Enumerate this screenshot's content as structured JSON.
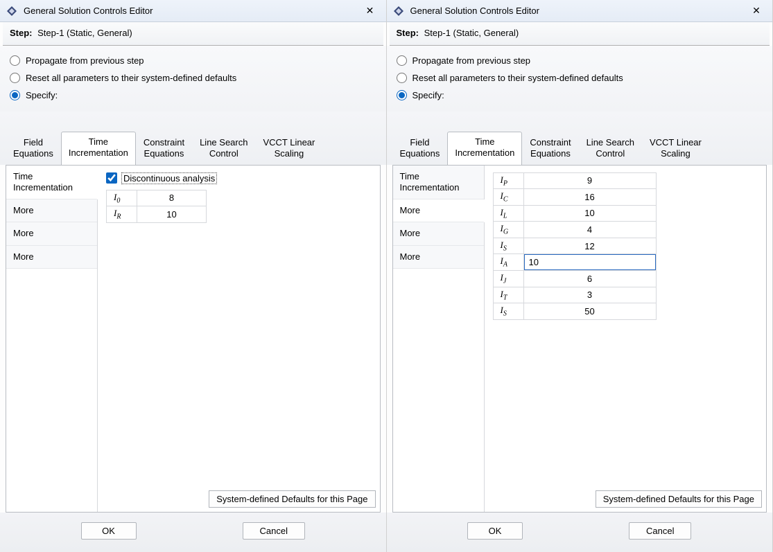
{
  "left": {
    "title": "General Solution Controls Editor",
    "step_label": "Step:",
    "step_value": "Step-1 (Static, General)",
    "radios": {
      "propagate": "Propagate from previous step",
      "reset": "Reset all parameters to their system-defined defaults",
      "specify": "Specify:"
    },
    "radio_selected": "specify",
    "tabs": [
      {
        "id": "field",
        "line1": "Field",
        "line2": "Equations"
      },
      {
        "id": "time",
        "line1": "Time",
        "line2": "Incrementation"
      },
      {
        "id": "constraint",
        "line1": "Constraint",
        "line2": "Equations"
      },
      {
        "id": "linesearch",
        "line1": "Line Search",
        "line2": "Control"
      },
      {
        "id": "vcct",
        "line1": "VCCT Linear",
        "line2": "Scaling"
      }
    ],
    "active_tab": "time",
    "subtabs": [
      {
        "id": "ti",
        "label": "Time Incrementation"
      },
      {
        "id": "m1",
        "label": "More"
      },
      {
        "id": "m2",
        "label": "More"
      },
      {
        "id": "m3",
        "label": "More"
      }
    ],
    "active_subtab": "ti",
    "discontinuous_checked": true,
    "discontinuous_label": "Discontinuous analysis",
    "params": [
      {
        "base": "I",
        "sub": "0",
        "value": "8"
      },
      {
        "base": "I",
        "sub": "R",
        "value": "10"
      }
    ],
    "defaults_btn": "System-defined Defaults for this Page",
    "ok": "OK",
    "cancel": "Cancel"
  },
  "right": {
    "title": "General Solution Controls Editor",
    "step_label": "Step:",
    "step_value": "Step-1 (Static, General)",
    "radios": {
      "propagate": "Propagate from previous step",
      "reset": "Reset all parameters to their system-defined defaults",
      "specify": "Specify:"
    },
    "radio_selected": "specify",
    "tabs": [
      {
        "id": "field",
        "line1": "Field",
        "line2": "Equations"
      },
      {
        "id": "time",
        "line1": "Time",
        "line2": "Incrementation"
      },
      {
        "id": "constraint",
        "line1": "Constraint",
        "line2": "Equations"
      },
      {
        "id": "linesearch",
        "line1": "Line Search",
        "line2": "Control"
      },
      {
        "id": "vcct",
        "line1": "VCCT Linear",
        "line2": "Scaling"
      }
    ],
    "active_tab": "time",
    "subtabs": [
      {
        "id": "ti",
        "label": "Time Incrementation"
      },
      {
        "id": "m1",
        "label": "More"
      },
      {
        "id": "m2",
        "label": "More"
      },
      {
        "id": "m3",
        "label": "More"
      }
    ],
    "active_subtab": "m1",
    "params": [
      {
        "base": "I",
        "sub": "P",
        "value": "9"
      },
      {
        "base": "I",
        "sub": "C",
        "value": "16"
      },
      {
        "base": "I",
        "sub": "L",
        "value": "10"
      },
      {
        "base": "I",
        "sub": "G",
        "value": "4"
      },
      {
        "base": "I",
        "sub": "S",
        "value": "12"
      },
      {
        "base": "I",
        "sub": "A",
        "value": "10",
        "editing": true
      },
      {
        "base": "I",
        "sub": "J",
        "value": "6"
      },
      {
        "base": "I",
        "sub": "T",
        "value": "3"
      },
      {
        "base": "I",
        "sub": "S",
        "hat": true,
        "value": "50"
      }
    ],
    "defaults_btn": "System-defined Defaults for this Page",
    "ok": "OK",
    "cancel": "Cancel"
  }
}
